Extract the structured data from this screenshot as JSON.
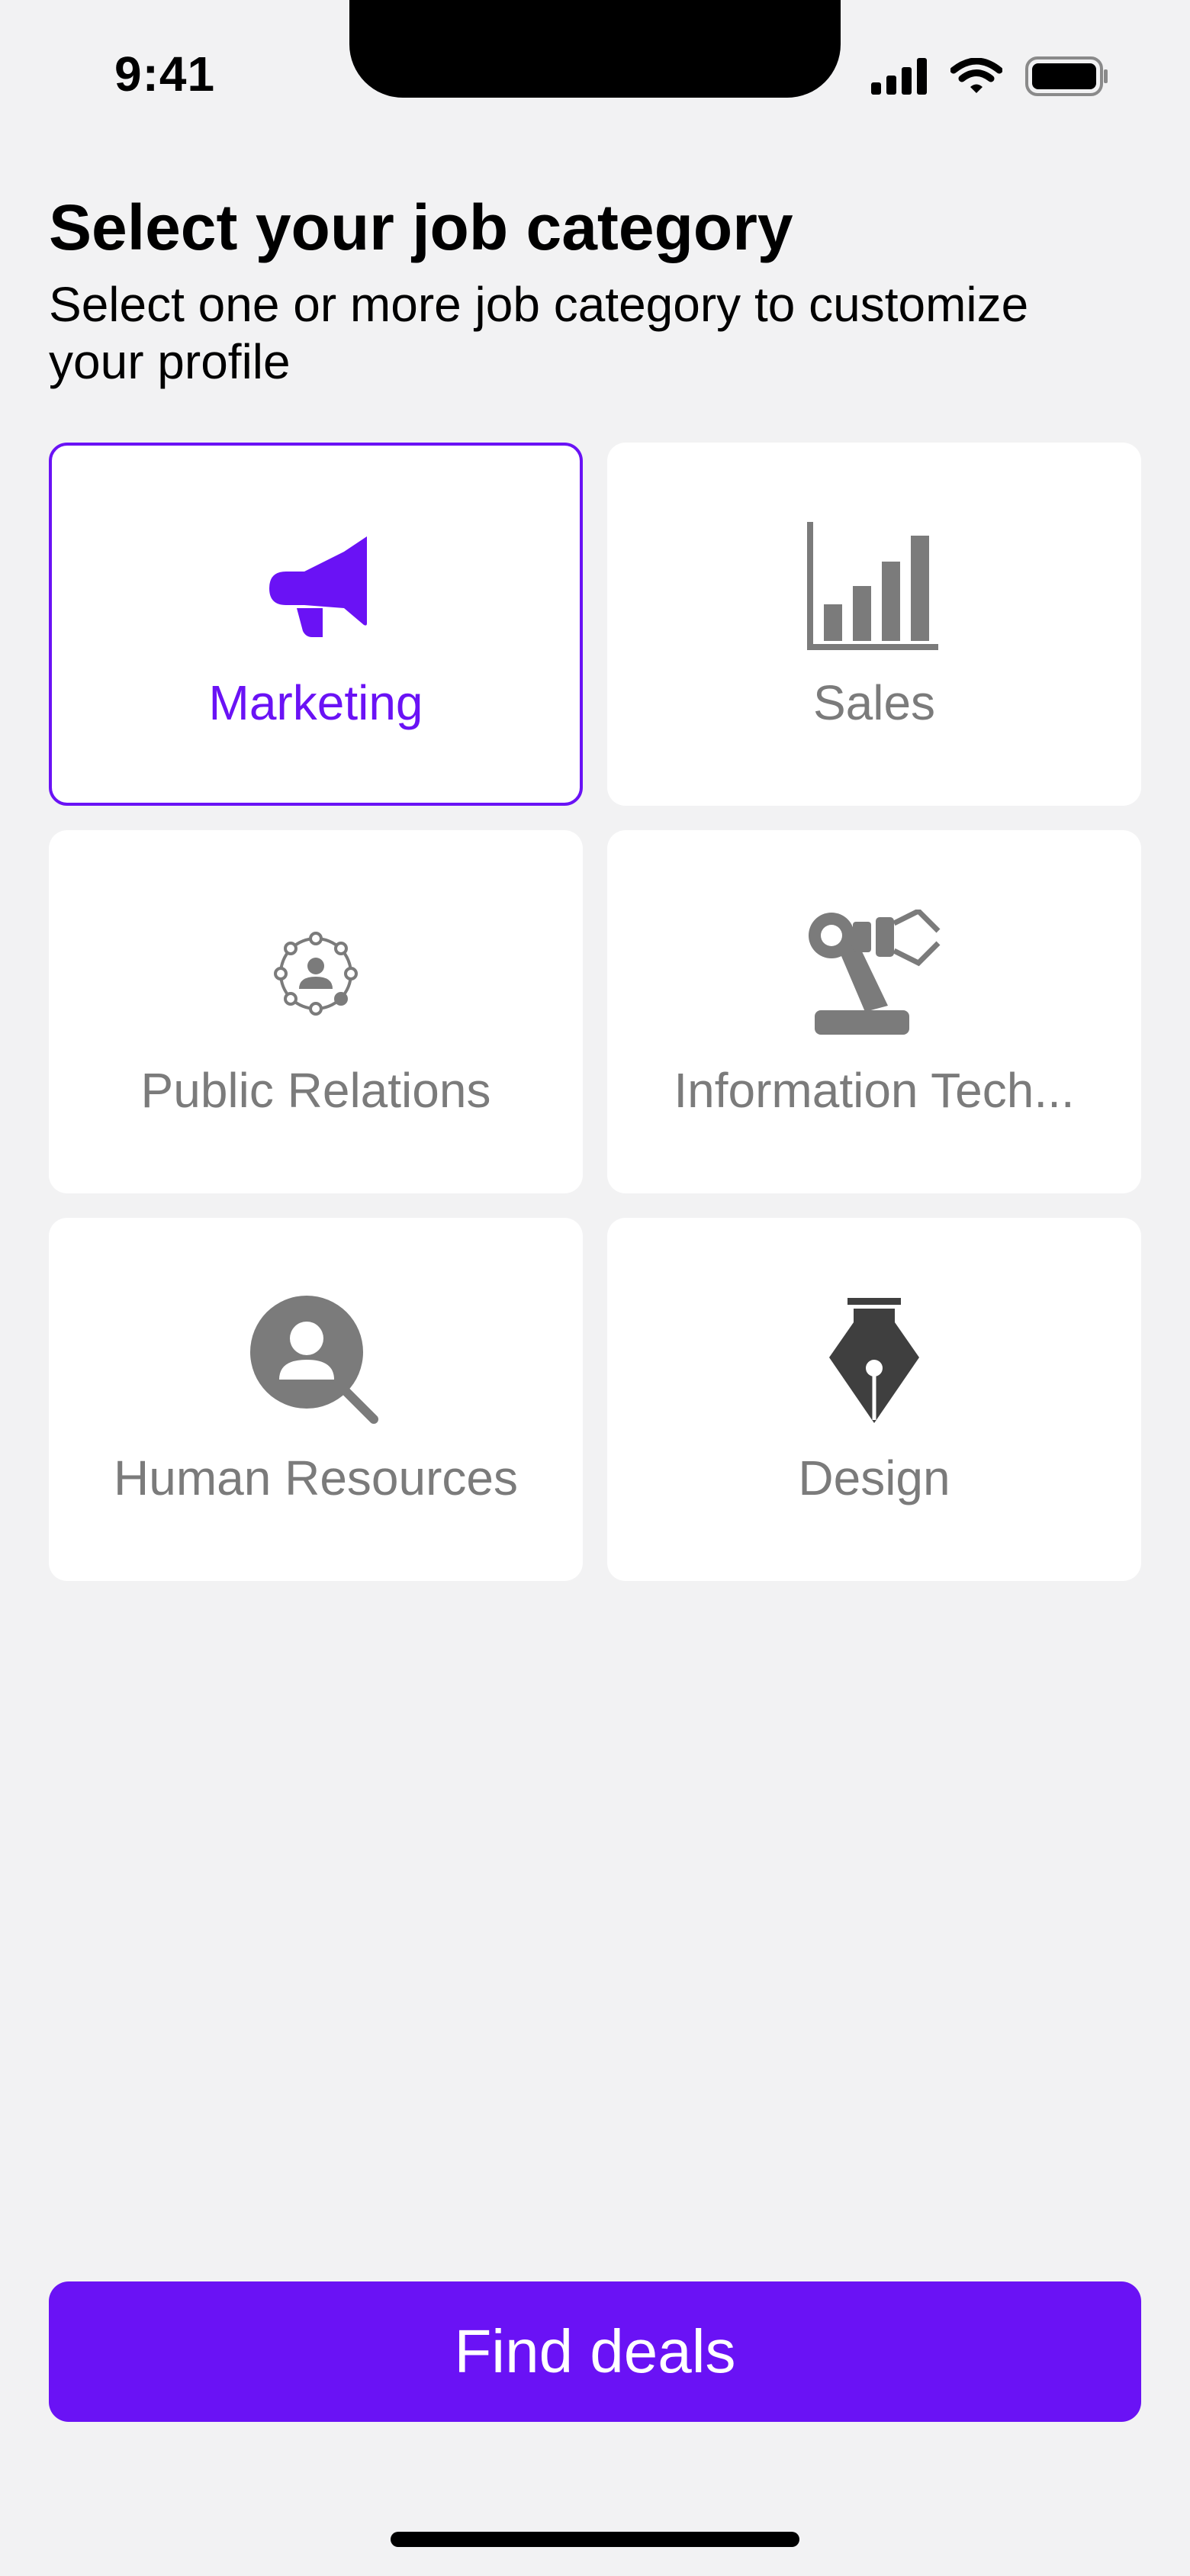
{
  "status_bar": {
    "time": "9:41",
    "icons": [
      "cellular-signal-icon",
      "wifi-icon",
      "battery-icon"
    ]
  },
  "header": {
    "title": "Select your job category",
    "subtitle": "Select one or more job category to customize your profile"
  },
  "categories": [
    {
      "label": "Marketing",
      "icon": "megaphone-icon",
      "selected": true
    },
    {
      "label": "Sales",
      "icon": "bar-chart-icon",
      "selected": false
    },
    {
      "label": "Public Relations",
      "icon": "network-person-icon",
      "selected": false
    },
    {
      "label": "Information Tech...",
      "icon": "robotic-arm-icon",
      "selected": false
    },
    {
      "label": "Human Resources",
      "icon": "person-search-icon",
      "selected": false
    },
    {
      "label": "Design",
      "icon": "pen-nib-icon",
      "selected": false
    }
  ],
  "action": {
    "label": "Find deals"
  },
  "colors": {
    "accent": "#6a12f5",
    "background": "#f2f2f3",
    "card": "#ffffff",
    "inactive": "#7b7b7b"
  }
}
